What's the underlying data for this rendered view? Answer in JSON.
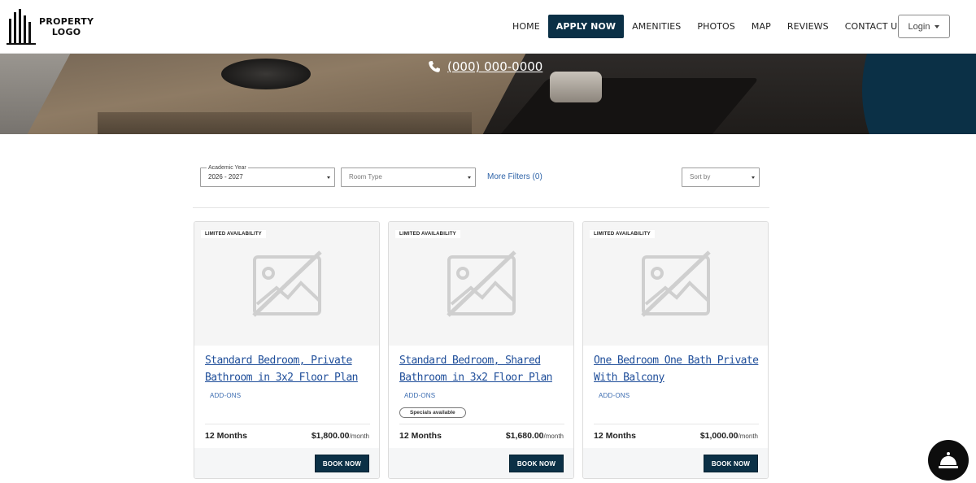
{
  "header": {
    "logo_line1": "PROPERTY",
    "logo_line2": "LOGO",
    "nav": [
      {
        "label": "HOME",
        "active": false
      },
      {
        "label": "APPLY NOW",
        "active": true
      },
      {
        "label": "AMENITIES",
        "active": false
      },
      {
        "label": "PHOTOS",
        "active": false
      },
      {
        "label": "MAP",
        "active": false
      },
      {
        "label": "REVIEWS",
        "active": false
      },
      {
        "label": "CONTACT US",
        "active": false
      }
    ],
    "login_label": "Login",
    "accent_color": "#0b3046"
  },
  "hero": {
    "phone": "(000) 000-0000",
    "phone_icon": "phone-icon"
  },
  "filters": {
    "academic_year_label": "Academic Year",
    "academic_year_value": "2026 - 2027",
    "room_type_placeholder": "Room Type",
    "more_filters": "More Filters (0)",
    "sort_placeholder": "Sort by"
  },
  "cards": [
    {
      "badge": "LIMITED AVAILABILITY",
      "title": "Standard Bedroom, Private Bathroom in 3x2 Floor Plan",
      "addons": "ADD-ONS",
      "specials": "",
      "term": "12 Months",
      "price": "$1,800.00",
      "per": "/month",
      "book": "BOOK NOW"
    },
    {
      "badge": "LIMITED AVAILABILITY",
      "title": "Standard Bedroom, Shared Bathroom in 3x2 Floor Plan",
      "addons": "ADD-ONS",
      "specials": "Specials available",
      "term": "12 Months",
      "price": "$1,680.00",
      "per": "/month",
      "book": "BOOK NOW"
    },
    {
      "badge": "LIMITED AVAILABILITY",
      "title": "One Bedroom One Bath Private With Balcony",
      "addons": "ADD-ONS",
      "specials": "",
      "term": "12 Months",
      "price": "$1,000.00",
      "per": "/month",
      "book": "BOOK NOW"
    }
  ],
  "chat": {
    "icon": "concierge-bell-icon"
  }
}
